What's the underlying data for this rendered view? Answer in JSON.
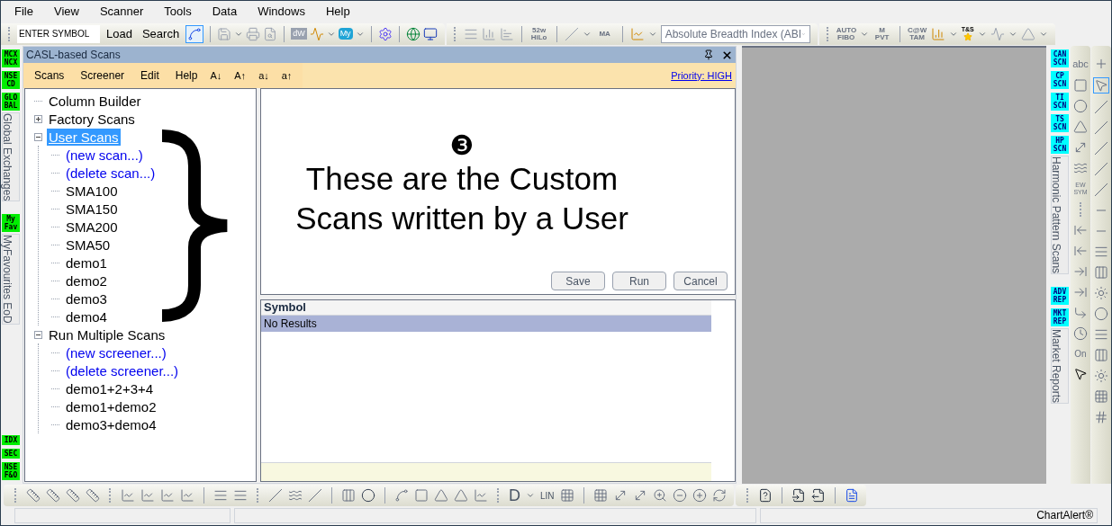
{
  "menu_bar": [
    "File",
    "View",
    "Scanner",
    "Tools",
    "Data",
    "Windows",
    "Help"
  ],
  "main_toolbar": {
    "symbol_field": {
      "value": "ENTER SYMBOL"
    },
    "buttons": [
      "Load",
      "Search"
    ],
    "icon_labels": [
      "dW",
      "My",
      "52w HiLo",
      "MA"
    ],
    "indicator_dropdown": {
      "value": "Absolute Breadth Index (ABI"
    },
    "tool_labels": [
      "AUTO FIBO",
      "M PVT",
      "C@W TAM",
      "T&S"
    ]
  },
  "left_dock": [
    {
      "badges": [
        {
          "lines": [
            "MCX",
            "NCX"
          ]
        },
        {
          "lines": [
            "NSE",
            "CD"
          ]
        },
        {
          "lines": [
            "GLO",
            "BAL"
          ]
        }
      ],
      "tab": "Global Exchanges"
    },
    {
      "badges": [
        {
          "lines": [
            "My",
            "Fav"
          ]
        }
      ],
      "tab": "MyFavourites EoD"
    },
    {
      "badges": [
        {
          "lines": [
            "IDX"
          ]
        },
        {
          "lines": [
            "SEC"
          ]
        },
        {
          "lines": [
            "NSE",
            "F&O"
          ]
        }
      ]
    }
  ],
  "panel": {
    "title": "CASL-based Scans",
    "menu": [
      "Scans",
      "Screener",
      "Edit",
      "Help"
    ],
    "sort_buttons": [
      "A↓",
      "A↑",
      "a↓",
      "a↑"
    ],
    "priority_link": "Priority: HIGH",
    "tree": [
      {
        "label": "Column Builder",
        "kind": "item",
        "selected": false
      },
      {
        "label": "Factory Scans",
        "kind": "folder",
        "expanded": false,
        "selected": false
      },
      {
        "label": "User Scans",
        "kind": "folder",
        "expanded": true,
        "selected": true,
        "children": [
          {
            "label": "(new scan...)",
            "kind": "action",
            "selected": false
          },
          {
            "label": "(delete scan...)",
            "kind": "action",
            "selected": false
          },
          {
            "label": "SMA100",
            "kind": "item",
            "selected": false
          },
          {
            "label": "SMA150",
            "kind": "item",
            "selected": false
          },
          {
            "label": "SMA200",
            "kind": "item",
            "selected": false
          },
          {
            "label": "SMA50",
            "kind": "item",
            "selected": false
          },
          {
            "label": "demo1",
            "kind": "item",
            "selected": false
          },
          {
            "label": "demo2",
            "kind": "item",
            "selected": false
          },
          {
            "label": "demo3",
            "kind": "item",
            "selected": false
          },
          {
            "label": "demo4",
            "kind": "item",
            "selected": false
          }
        ]
      },
      {
        "label": "Run Multiple Scans",
        "kind": "folder",
        "expanded": true,
        "selected": false,
        "children": [
          {
            "label": "(new screener...)",
            "kind": "action",
            "selected": false
          },
          {
            "label": "(delete screener...)",
            "kind": "action",
            "selected": false
          },
          {
            "label": "demo1+2+3+4",
            "kind": "item",
            "selected": false
          },
          {
            "label": "demo1+demo2",
            "kind": "item",
            "selected": false
          },
          {
            "label": "demo3+demo4",
            "kind": "item",
            "selected": false
          }
        ]
      }
    ],
    "annotation": {
      "number": "❸",
      "lines": [
        "These are the Custom",
        "Scans written by a User"
      ]
    },
    "editor_buttons": [
      "Save",
      "Run",
      "Cancel"
    ],
    "results": {
      "columns": [
        "Symbol"
      ],
      "rows": [
        [
          "No Results"
        ]
      ]
    }
  },
  "right_dock": [
    {
      "badges": [
        {
          "lines": [
            "CAN",
            "SCN"
          ]
        },
        {
          "lines": [
            "CP",
            "SCN"
          ]
        },
        {
          "lines": [
            "TI",
            "SCN"
          ]
        },
        {
          "lines": [
            "TS",
            "SCN"
          ]
        },
        {
          "lines": [
            "HP",
            "SCN"
          ]
        }
      ],
      "tab": "Harmonic Pattern Scans"
    },
    {
      "badges": [
        {
          "lines": [
            "ADV",
            "REP"
          ]
        },
        {
          "lines": [
            "MKT",
            "REP"
          ]
        }
      ],
      "tab": "Market Reports"
    }
  ],
  "drawing_toolbar_labels": [
    "abc",
    "EW SYM",
    "On"
  ],
  "bottom_toolbar_labels": [
    "D",
    "LIN"
  ],
  "status_bar": {
    "text": "ChartAlert®"
  }
}
